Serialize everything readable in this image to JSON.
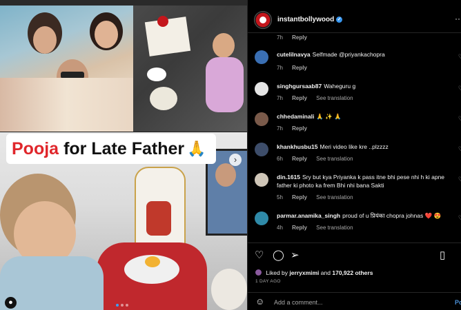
{
  "post": {
    "caption_highlight": "Pooja",
    "caption_rest": "for Late Father",
    "caption_emoji": "🙏"
  },
  "header": {
    "username": "instantbollywood",
    "more": "···"
  },
  "first_meta": {
    "time": "7h",
    "reply": "Reply"
  },
  "comments": [
    {
      "user": "cutelilnavya",
      "text": "Selfmade @priyankachopra",
      "time": "7h",
      "reply": "Reply",
      "translation": "",
      "avatar_color": "#3a6fb3"
    },
    {
      "user": "singhgursaab87",
      "text": "Waheguru g",
      "time": "7h",
      "reply": "Reply",
      "translation": "See translation",
      "avatar_color": "#e5e5e5"
    },
    {
      "user": "chhedaminali",
      "text": "🙏 ✨ 🙏",
      "time": "7h",
      "reply": "Reply",
      "translation": "",
      "avatar_color": "#7a5a4a"
    },
    {
      "user": "khankhusbu15",
      "text": "Meri video like kre ..plzzzz",
      "time": "6h",
      "reply": "Reply",
      "translation": "See translation",
      "avatar_color": "#3d4d6a"
    },
    {
      "user": "din.1615",
      "text": "Sry but kya Priyanka k pass itne bhi pese nhi h ki apne father ki photo ka frem Bhi nhi bana Sakti",
      "time": "5h",
      "reply": "Reply",
      "translation": "See translation",
      "avatar_color": "#cfc6b8"
    },
    {
      "user": "parmar.anamika_singh",
      "text": "proud of u प्रियंका chopra johnas ❤️ 😍",
      "time": "4h",
      "reply": "Reply",
      "translation": "See translation",
      "avatar_color": "#2f8aa8"
    }
  ],
  "likes": {
    "prefix": "Liked by",
    "user": "jerryxmimi",
    "middle": "and",
    "count": "170,922 others"
  },
  "date": "1 DAY AGO",
  "add_comment": {
    "placeholder": "Add a comment...",
    "post_label": "Po"
  },
  "colors": {
    "accent": "#3897f0",
    "caption_red": "#e0262b",
    "post_blue": "#4a8fd6"
  }
}
